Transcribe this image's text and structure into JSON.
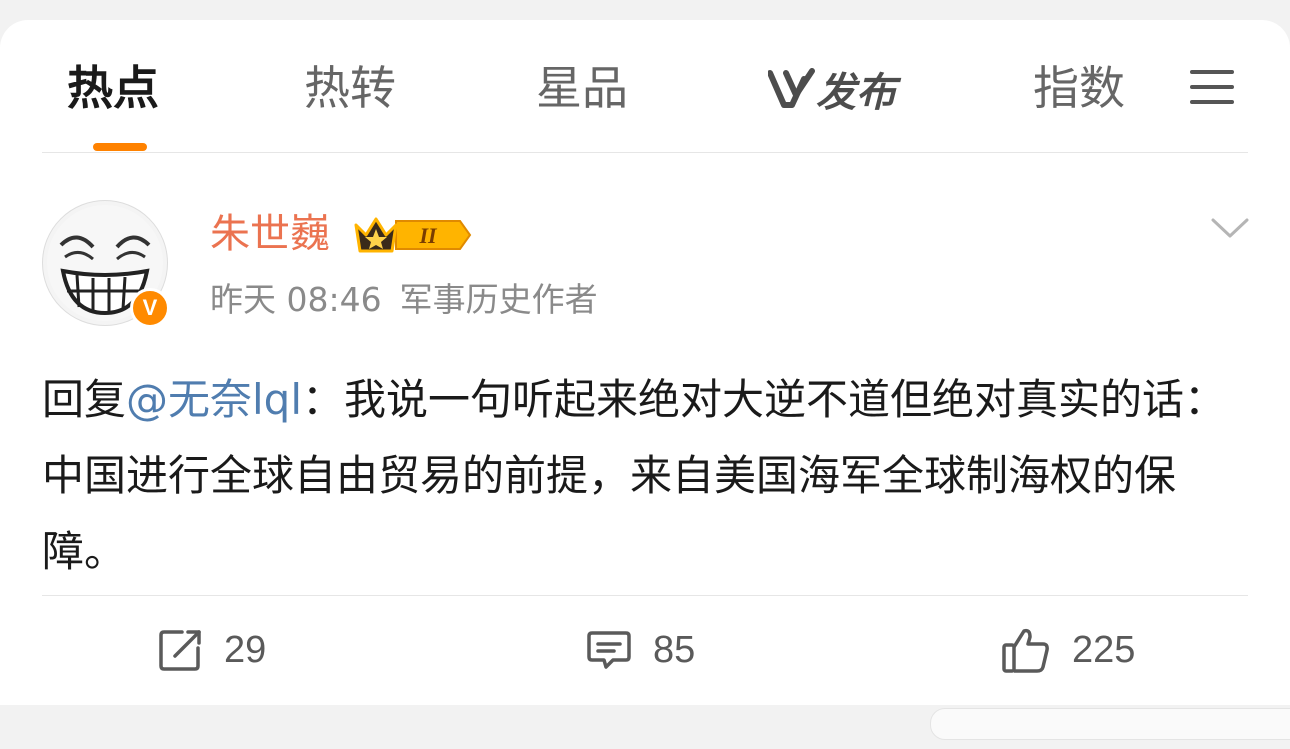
{
  "tabs": {
    "items": [
      {
        "label": "热点",
        "active": true
      },
      {
        "label": "热转",
        "active": false
      },
      {
        "label": "星品",
        "active": false
      },
      {
        "label": "发布",
        "active": false
      },
      {
        "label": "指数",
        "active": false
      }
    ],
    "accent": "#ff8200",
    "menu_icon": "hamburger-icon"
  },
  "post": {
    "author": "朱世巍",
    "verified_icon": "verified-v-icon",
    "rank_badge_text": "II",
    "time": "昨天 08:46",
    "description": "军事历史作者",
    "reply_prefix": "回复",
    "mention": "@无奈lql",
    "text": "：我说一句听起来绝对大逆不道但绝对真实的话：中国进行全球自由贸易的前提，来自美国海军全球制海权的保障。",
    "colors": {
      "author": "#eb7350",
      "mention": "#507daf"
    }
  },
  "actions": {
    "repost": {
      "icon": "repost-icon",
      "count": "29"
    },
    "comment": {
      "icon": "comment-icon",
      "count": "85"
    },
    "like": {
      "icon": "thumbs-up-icon",
      "count": "225"
    }
  }
}
